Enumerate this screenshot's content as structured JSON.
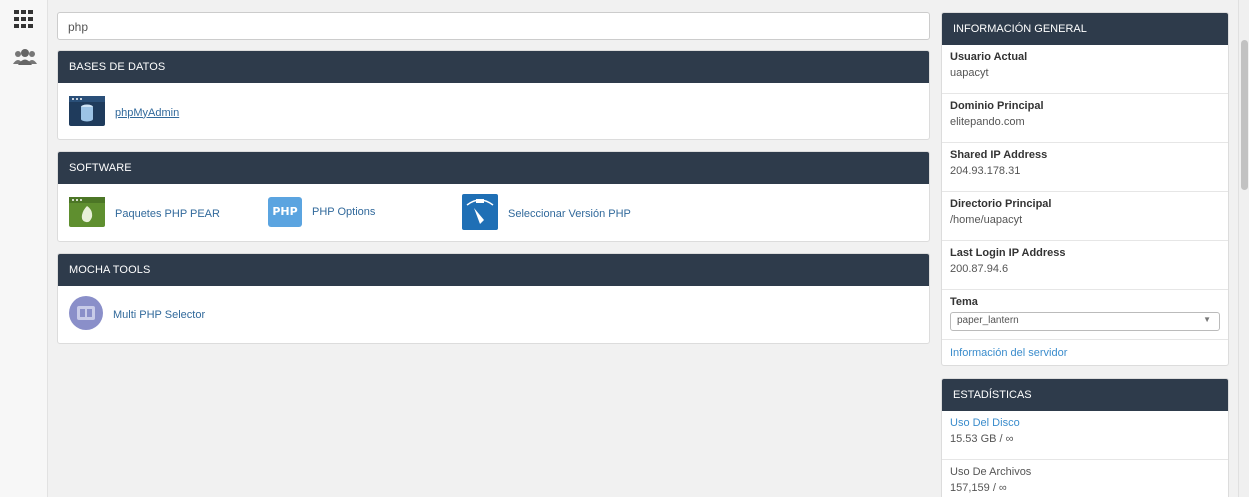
{
  "search": {
    "value": "php"
  },
  "leftbar": {
    "icons": [
      "grid-icon",
      "users-icon"
    ]
  },
  "sections": {
    "databases": {
      "title": "BASES DE DATOS",
      "items": [
        {
          "label": "phpMyAdmin",
          "icon": "phpmyadmin-icon"
        }
      ]
    },
    "software": {
      "title": "SOFTWARE",
      "items": [
        {
          "label": "Paquetes PHP PEAR",
          "icon": "pear-icon"
        },
        {
          "label": "PHP Options",
          "icon": "php-icon",
          "icon_text": "PHP"
        },
        {
          "label": "Seleccionar Versión PHP",
          "icon": "php-version-icon"
        }
      ]
    },
    "mocha": {
      "title": "MOCHA TOOLS",
      "items": [
        {
          "label": "Multi PHP Selector",
          "icon": "multi-php-icon"
        }
      ]
    }
  },
  "general_info": {
    "title": "INFORMACIÓN GENERAL",
    "rows": [
      {
        "label": "Usuario Actual",
        "value": "uapacyt"
      },
      {
        "label": "Dominio Principal",
        "value": "elitepando.com"
      },
      {
        "label": "Shared IP Address",
        "value": "204.93.178.31"
      },
      {
        "label": "Directorio Principal",
        "value": "/home/uapacyt"
      },
      {
        "label": "Last Login IP Address",
        "value": "200.87.94.6"
      }
    ],
    "theme": {
      "label": "Tema",
      "selected": "paper_lantern"
    },
    "server_info_link": "Información del servidor"
  },
  "stats": {
    "title": "ESTADÍSTICAS",
    "rows": [
      {
        "label": "Uso Del Disco",
        "value": "15.53 GB / ∞"
      },
      {
        "label": "Uso De Archivos",
        "value": "157,159 / ∞"
      }
    ]
  },
  "colors": {
    "header_bg": "#2e3b4b",
    "link": "#31699b",
    "side_link": "#3a8ccc"
  }
}
